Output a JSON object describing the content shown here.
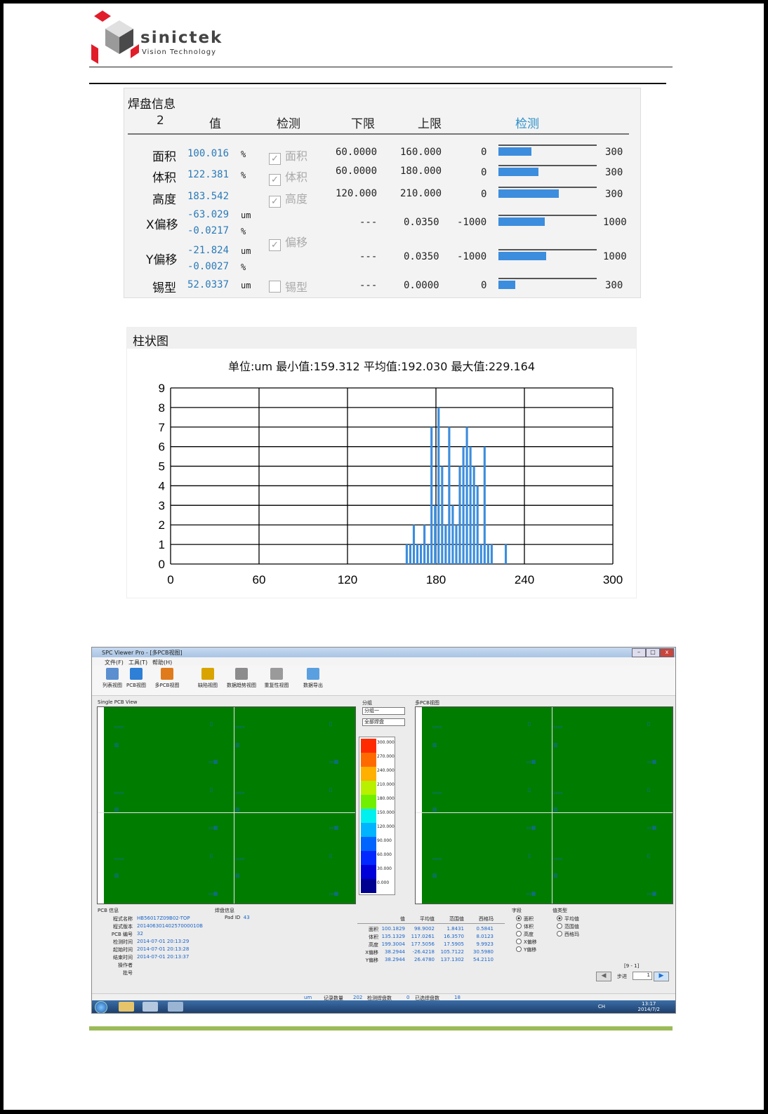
{
  "brand": {
    "name": "sinictek",
    "tagline": "Vision Technology"
  },
  "pad_info": {
    "title": "焊盘信息",
    "headers": {
      "index": "2",
      "value": "值",
      "check": "检测",
      "lower": "下限",
      "upper": "上限",
      "detect": "检测"
    },
    "rows": [
      {
        "label": "面积",
        "value": "100.016",
        "unit": "%",
        "check_label": "面积",
        "checked": true,
        "lower": "60.0000",
        "upper": "160.000",
        "min": "0",
        "max": "300",
        "bar_fraction": 0.333
      },
      {
        "label": "体积",
        "value": "122.381",
        "unit": "%",
        "check_label": "体积",
        "checked": true,
        "lower": "60.0000",
        "upper": "180.000",
        "min": "0",
        "max": "300",
        "bar_fraction": 0.408
      },
      {
        "label": "高度",
        "value": "183.542",
        "unit": "",
        "check_label": "高度",
        "checked": true,
        "lower": "120.000",
        "upper": "210.000",
        "min": "0",
        "max": "300",
        "bar_fraction": 0.612
      },
      {
        "label": "X偏移",
        "value": "-63.029",
        "unit": "um",
        "value2": "-0.0217",
        "unit2": "%",
        "lower": "---",
        "upper": "0.0350",
        "min": "-1000",
        "max": "1000",
        "bar_fraction": 0.468
      },
      {
        "label": "Y偏移",
        "value": "-21.824",
        "unit": "um",
        "value2": "-0.0027",
        "unit2": "%",
        "lower": "---",
        "upper": "0.0350",
        "min": "-1000",
        "max": "1000",
        "bar_fraction": 0.489
      },
      {
        "label": "锡型",
        "value": "52.0337",
        "unit": "um",
        "check_label": "锡型",
        "checked": false,
        "lower": "---",
        "upper": "0.0000",
        "min": "0",
        "max": "300",
        "bar_fraction": 0.173
      }
    ],
    "offset_check": {
      "label": "偏移",
      "checked": true
    }
  },
  "histogram_panel": {
    "title": "柱状图",
    "subtitle": "单位:um 最小值:159.312 平均值:192.030 最大值:229.164"
  },
  "chart_data": {
    "type": "bar",
    "title": "单位:um 最小值:159.312 平均值:192.030 最大值:229.164",
    "xlim": [
      0,
      300
    ],
    "ylim": [
      0,
      9
    ],
    "xticks": [
      "0",
      "60",
      "120",
      "180",
      "240",
      "300"
    ],
    "yticks": [
      "0",
      "1",
      "2",
      "3",
      "4",
      "5",
      "6",
      "7",
      "8",
      "9"
    ],
    "bin_width": 2.4,
    "x": [
      160.2,
      162.6,
      165.0,
      167.4,
      169.8,
      172.2,
      174.6,
      177.0,
      179.4,
      181.8,
      184.2,
      186.6,
      189.0,
      191.4,
      193.8,
      196.2,
      198.6,
      201.0,
      203.4,
      205.8,
      208.2,
      210.6,
      213.0,
      215.4,
      217.8,
      220.2,
      222.6,
      225.0,
      227.4
    ],
    "values": [
      1,
      1,
      2,
      1,
      1,
      2,
      1,
      7,
      3,
      8,
      5,
      2,
      7,
      3,
      2,
      5,
      6,
      7,
      6,
      5,
      4,
      1,
      6,
      1,
      1,
      0,
      0,
      0,
      1
    ]
  },
  "screenshot": {
    "window_title": "SPC Viewer Pro - [多PCB视图]",
    "menus": [
      "文件(F)",
      "工具(T)",
      "帮助(H)"
    ],
    "toolbar": [
      {
        "label": "列表视图",
        "color": "#5b8fd0"
      },
      {
        "label": "PCB视图",
        "color": "#2e7fd6"
      },
      {
        "label": "多PCB视图",
        "color": "#e07b1c"
      },
      {
        "label": "缺陷视图",
        "color": "#d9a400"
      },
      {
        "label": "数据趋势视图",
        "color": "#8c8c8c"
      },
      {
        "label": "重复性视图",
        "color": "#9a9a9a"
      },
      {
        "label": "数据导出",
        "color": "#5aa0e0"
      }
    ],
    "left_view_label": "Single PCB View",
    "right_view_label": "多PCB视图",
    "group_label": "分组",
    "group_select": "分组一",
    "pad_select": "全部焊盘",
    "legend": {
      "values": [
        "300.000",
        "270.000",
        "240.000",
        "210.000",
        "180.000",
        "150.000",
        "120.000",
        "90.000",
        "60.000",
        "30.000",
        "0.000"
      ],
      "colors": [
        "#ff2a00",
        "#ff6a00",
        "#ffb000",
        "#b8f000",
        "#70f000",
        "#00f0f0",
        "#00b4ff",
        "#0064ff",
        "#0028ff",
        "#0000d8",
        "#000090"
      ]
    },
    "pcb_info": {
      "title": "PCB 信息",
      "fields": [
        {
          "k": "程式名称",
          "v": "HB56017Z09B02-TOP"
        },
        {
          "k": "程式版本",
          "v": "20140630140257000010B"
        },
        {
          "k": "PCB 编号",
          "v": "32"
        },
        {
          "k": "检测时间",
          "v": "2014-07-01 20:13:29"
        },
        {
          "k": "起始时间",
          "v": "2014-07-01 20:13:28"
        },
        {
          "k": "结束时间",
          "v": "2014-07-01 20:13:37"
        },
        {
          "k": "操作者",
          "v": ""
        },
        {
          "k": "批号",
          "v": ""
        }
      ]
    },
    "pad_info_small": {
      "title": "焊盘信息",
      "k": "Pad ID",
      "v": "43"
    },
    "stats": {
      "headers": [
        "值",
        "平均值",
        "范围值",
        "西格玛"
      ],
      "rows": [
        {
          "name": "面积",
          "vals": [
            "100.1829",
            "98.9002",
            "1.8431",
            "0.5841"
          ]
        },
        {
          "name": "体积",
          "vals": [
            "135.1329",
            "117.0261",
            "16.3570",
            "8.0123"
          ]
        },
        {
          "name": "高度",
          "vals": [
            "199.3004",
            "177.5056",
            "17.5905",
            "9.9923"
          ]
        },
        {
          "name": "X偏移",
          "vals": [
            "38.2944",
            "-26.4218",
            "105.7122",
            "30.5980"
          ]
        },
        {
          "name": "Y偏移",
          "vals": [
            "38.2944",
            "26.4780",
            "137.1302",
            "54.2110"
          ]
        }
      ]
    },
    "attributes": {
      "title": "字段",
      "items": [
        "面积",
        "体积",
        "高度",
        "X偏移",
        "Y偏移"
      ],
      "selected": 0
    },
    "value_type": {
      "title": "值类型",
      "items": [
        "平均值",
        "范围值",
        "西格玛"
      ],
      "selected": 0
    },
    "pager": {
      "range": "[9 - 1]",
      "step_label": "步进",
      "step": "1"
    },
    "status": {
      "unit": "um",
      "records_label": "记录数量",
      "records": "202",
      "checked_pads_label": "检测焊盘数",
      "checked_pads": "0",
      "selected_pads_label": "已选焊盘数",
      "selected_pads": "18"
    },
    "clock": {
      "time": "13:17",
      "date": "2014/7/2"
    },
    "tray": "CH"
  }
}
